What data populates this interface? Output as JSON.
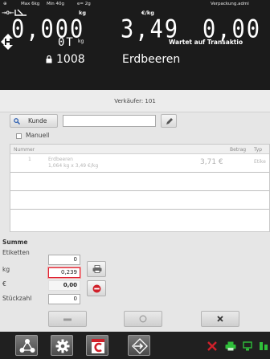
{
  "display": {
    "max_label": "Max 6kg",
    "min_label": "Min 40g",
    "e_label": "e= 2g",
    "user_label": "Verpackung.admi",
    "weight_unit": "kg",
    "price_unit": "€/kg",
    "weight_value": "0,000",
    "unit_price_value": "3,49",
    "total_value": "0,00",
    "tare_value": "0T",
    "tare_unit": "kg",
    "status_text": "Wartet auf Transaktio",
    "plu_number": "1008",
    "plu_name": "Erdbeeren"
  },
  "seller": {
    "text": "Verkäufer: 101"
  },
  "customer": {
    "button_label": "Kunde",
    "input_value": "",
    "manual_label": "Manuell",
    "manual_checked": false
  },
  "table": {
    "headers": {
      "number": "Nummer",
      "amount": "Betrag",
      "type": "Typ"
    },
    "rows": [
      {
        "pos": "1",
        "article": "Erdbeeren",
        "detail": "1,064 kg x 3,49 €/kg",
        "amount": "3,71 €",
        "type": "Etike"
      }
    ]
  },
  "summary": {
    "title": "Summe",
    "labels_label": "Etiketten",
    "labels_value": "0",
    "kg_label": "kg",
    "kg_value": "0,239",
    "euro_label": "€",
    "euro_value": "0,00",
    "pieces_label": "Stückzahl",
    "pieces_value": "0"
  },
  "colors": {
    "display_bg": "#1b1b1b",
    "taskbar_bg": "#202020",
    "cancel_red": "#d0202a",
    "tray_green": "#2fbf3a"
  },
  "icons": {
    "zero": "zero-arrows-icon",
    "lock": "lock-icon",
    "search": "search-icon",
    "edit": "pencil-icon",
    "print": "printer-icon",
    "cancel": "cancel-icon",
    "minus": "minus-icon",
    "circle": "circle-icon",
    "close": "close-icon",
    "network": "network-icon",
    "settings": "gear-icon",
    "app": "app-c-icon",
    "transfer": "transfer-icon"
  }
}
